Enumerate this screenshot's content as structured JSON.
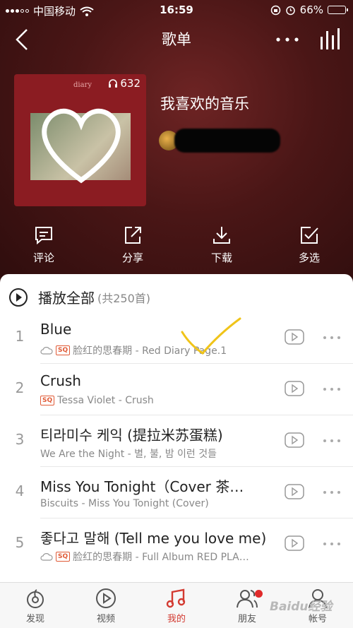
{
  "status_bar": {
    "carrier": "中国移动",
    "time": "16:59",
    "battery": "66%",
    "battery_level": 0.66
  },
  "nav": {
    "title": "歌单",
    "back_icon": "chevron-left-icon",
    "more_icon": "more-horizontal-icon",
    "eq_icon": "equalizer-icon"
  },
  "playlist": {
    "play_count": "632",
    "cover_label": "diary",
    "title": "我喜欢的音乐"
  },
  "actions": [
    {
      "label": "评论",
      "icon": "comment-icon"
    },
    {
      "label": "分享",
      "icon": "share-icon"
    },
    {
      "label": "下载",
      "icon": "download-icon"
    },
    {
      "label": "多选",
      "icon": "multi-select-icon"
    }
  ],
  "play_all": {
    "label": "播放全部",
    "count": "(共250首)"
  },
  "songs": [
    {
      "index": "1",
      "title": "Blue",
      "subtitle": "脸红的思春期 - Red Diary Page.1",
      "cloud": true,
      "sq": true
    },
    {
      "index": "2",
      "title": "Crush",
      "subtitle": "Tessa Violet - Crush",
      "cloud": false,
      "sq": true
    },
    {
      "index": "3",
      "title": "티라미수 케익 (提拉米苏蛋糕)",
      "subtitle": "We Are the Night - 별, 불, 밤 이런 것들",
      "cloud": false,
      "sq": false
    },
    {
      "index": "4",
      "title": "Miss You Tonight（Cover 茶…",
      "subtitle": "Biscuits - Miss You Tonight (Cover)",
      "cloud": false,
      "sq": false
    },
    {
      "index": "5",
      "title": "좋다고 말해 (Tell me you love me)",
      "subtitle": "脸红的思春期 - Full Album RED PLA…",
      "cloud": true,
      "sq": true
    }
  ],
  "sq_label": "SQ",
  "tabs": [
    {
      "label": "发现",
      "icon": "netease-logo-icon",
      "active": false
    },
    {
      "label": "视频",
      "icon": "video-icon",
      "active": false
    },
    {
      "label": "我的",
      "icon": "music-note-icon",
      "active": true
    },
    {
      "label": "朋友",
      "icon": "friends-icon",
      "active": false,
      "badge": true
    },
    {
      "label": "帐号",
      "icon": "account-icon",
      "active": false
    }
  ],
  "watermark": "Baidu经验",
  "colors": {
    "accent": "#d33a31",
    "hero": "#4a1616",
    "sq": "#e05a36",
    "check": "#f0c419"
  }
}
